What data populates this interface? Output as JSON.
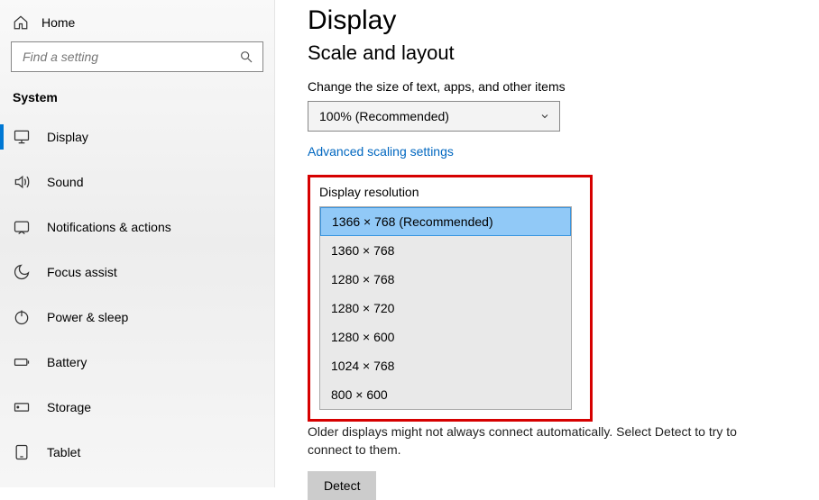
{
  "sidebar": {
    "home": "Home",
    "search_placeholder": "Find a setting",
    "group": "System",
    "items": [
      {
        "label": "Display",
        "icon": "monitor-icon",
        "active": true
      },
      {
        "label": "Sound",
        "icon": "sound-icon"
      },
      {
        "label": "Notifications & actions",
        "icon": "notification-icon"
      },
      {
        "label": "Focus assist",
        "icon": "moon-icon"
      },
      {
        "label": "Power & sleep",
        "icon": "power-icon"
      },
      {
        "label": "Battery",
        "icon": "battery-icon"
      },
      {
        "label": "Storage",
        "icon": "storage-icon"
      },
      {
        "label": "Tablet",
        "icon": "tablet-icon"
      }
    ]
  },
  "main": {
    "title": "Display",
    "section": "Scale and layout",
    "scale_label": "Change the size of text, apps, and other items",
    "scale_value": "100% (Recommended)",
    "advanced_link": "Advanced scaling settings",
    "resolution_label": "Display resolution",
    "resolution_options": [
      "1366 × 768 (Recommended)",
      "1360 × 768",
      "1280 × 768",
      "1280 × 720",
      "1280 × 600",
      "1024 × 768",
      "800 × 600"
    ],
    "note": "Older displays might not always connect automatically. Select Detect to try to connect to them.",
    "detect_button": "Detect"
  }
}
